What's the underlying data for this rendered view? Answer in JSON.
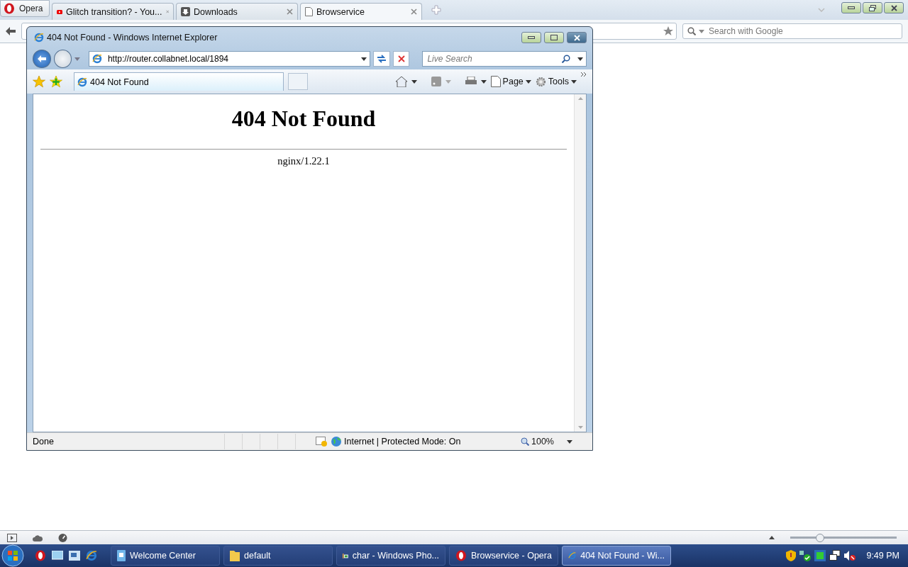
{
  "opera": {
    "menu_button": "Opera",
    "tabs": [
      {
        "title": "Glitch transition? - You...",
        "kind": "video",
        "selected": false
      },
      {
        "title": "Downloads",
        "kind": "download",
        "selected": false
      },
      {
        "title": "Browservice",
        "kind": "page",
        "selected": true
      }
    ],
    "search": {
      "placeholder": "Search with Google"
    },
    "zoom": {
      "level": 0.28
    }
  },
  "ie": {
    "title": "404 Not Found - Windows Internet Explorer",
    "address": "http://router.collabnet.local/1894",
    "search": {
      "placeholder": "Live Search"
    },
    "tab": {
      "title": "404 Not Found"
    },
    "toolbar": [
      "Page",
      "Tools"
    ],
    "page": {
      "heading": "404 Not Found",
      "server": "nginx/1.22.1"
    },
    "status": {
      "text": "Done",
      "zone": "Internet | Protected Mode: On",
      "zoom": "100%"
    }
  },
  "taskbar": {
    "buttons": [
      {
        "label": "Welcome Center",
        "kind": "welcome",
        "selected": false
      },
      {
        "label": "default",
        "kind": "folder",
        "selected": false
      },
      {
        "label": "char - Windows Pho...",
        "kind": "photo",
        "selected": false
      },
      {
        "label": "Browservice - Opera",
        "kind": "opera",
        "selected": false
      },
      {
        "label": "404 Not Found - Wi...",
        "kind": "ie",
        "selected": true
      }
    ],
    "clock": "9:49 PM"
  }
}
